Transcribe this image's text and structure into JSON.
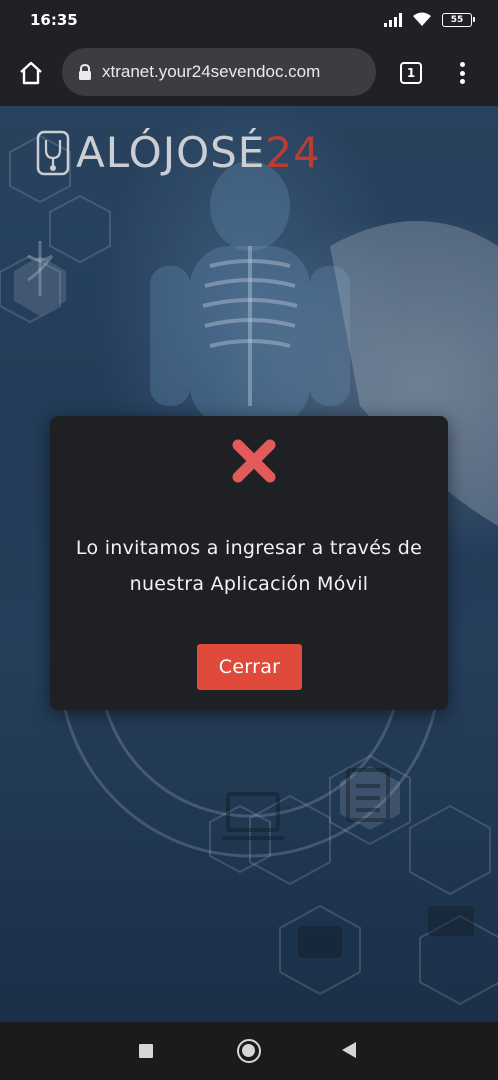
{
  "status_bar": {
    "time": "16:35",
    "battery": "55",
    "icons": [
      "signal-icon",
      "wifi-icon",
      "battery-icon"
    ]
  },
  "browser": {
    "url": "xtranet.your24sevendoc.com",
    "tab_count": "1",
    "icons": [
      "home-icon",
      "lock-icon",
      "tabs-icon",
      "menu-icon"
    ]
  },
  "page": {
    "logo": {
      "text_main": "ALÓJOSÉ",
      "text_accent": "24",
      "accent_color": "#d9443a"
    }
  },
  "modal": {
    "icon": "error-x-icon",
    "icon_color": "#e35a5a",
    "message_line1": "Lo invitamos a ingresar a través de",
    "message_line2": "nuestra Aplicación Móvil",
    "button_label": "Cerrar",
    "button_color": "#df4a3a"
  },
  "nav_bar": {
    "icons": [
      "recents-icon",
      "home-circle-icon",
      "back-icon"
    ]
  }
}
